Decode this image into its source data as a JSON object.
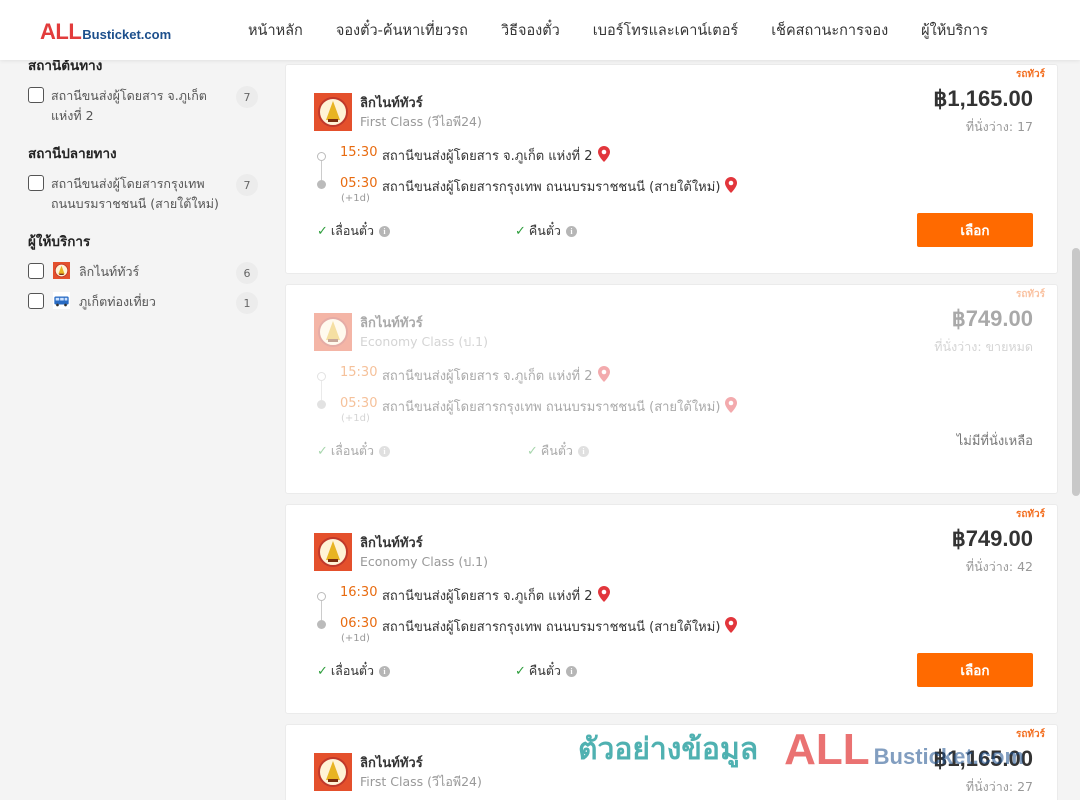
{
  "logo": {
    "all": "ALL",
    "rest": "Busticket.com"
  },
  "nav": [
    "หน้าหลัก",
    "จองตั๋ว-ค้นหาเที่ยวรถ",
    "วิธีจองตั๋ว",
    "เบอร์โทรและเคาน์เตอร์",
    "เช็คสถานะการจอง",
    "ผู้ให้บริการ"
  ],
  "sidebar": {
    "origin_heading": "สถานีต้นทาง",
    "origin_items": [
      {
        "label": "สถานีขนส่งผู้โดยสาร จ.ภูเก็ต แห่งที่ 2",
        "count": "7"
      }
    ],
    "dest_heading": "สถานีปลายทาง",
    "dest_items": [
      {
        "label": "สถานีขนส่งผู้โดยสารกรุงเทพ ถนนบรมราชชนนี (สายใต้ใหม่)",
        "count": "7"
      }
    ],
    "operator_heading": "ผู้ให้บริการ",
    "operator_items": [
      {
        "label": "ลิกไนท์ทัวร์",
        "count": "6"
      },
      {
        "label": "ภูเก็ตท่องเที่ยว",
        "count": "1"
      }
    ]
  },
  "trips": [
    {
      "tag": "รถทัวร์",
      "operator": "ลิกไนท์ทัวร์",
      "bus_class": "First Class (วีไอพี24)",
      "price": "฿1,165.00",
      "seats": "ที่นั่งว่าง: 17",
      "depart_time": "15:30",
      "depart_station": "สถานีขนส่งผู้โดยสาร จ.ภูเก็ต แห่งที่ 2",
      "arrive_time": "05:30",
      "arrive_station": "สถานีขนส่งผู้โดยสารกรุงเทพ ถนนบรมราชชนนี (สายใต้ใหม่)",
      "plus_day": "(+1d)",
      "policy_postpone": "เลื่อนตั๋ว",
      "policy_refund": "คืนตั๋ว",
      "action": "เลือก"
    },
    {
      "tag": "รถทัวร์",
      "operator": "ลิกไนท์ทัวร์",
      "bus_class": "Economy Class (ป.1)",
      "price": "฿749.00",
      "seats": "ที่นั่งว่าง: ขายหมด",
      "depart_time": "15:30",
      "depart_station": "สถานีขนส่งผู้โดยสาร จ.ภูเก็ต แห่งที่ 2",
      "arrive_time": "05:30",
      "arrive_station": "สถานีขนส่งผู้โดยสารกรุงเทพ ถนนบรมราชชนนี (สายใต้ใหม่)",
      "plus_day": "(+1d)",
      "policy_postpone": "เลื่อนตั๋ว",
      "policy_refund": "คืนตั๋ว",
      "sold_out_text": "ไม่มีที่นั่งเหลือ"
    },
    {
      "tag": "รถทัวร์",
      "operator": "ลิกไนท์ทัวร์",
      "bus_class": "Economy Class (ป.1)",
      "price": "฿749.00",
      "seats": "ที่นั่งว่าง: 42",
      "depart_time": "16:30",
      "depart_station": "สถานีขนส่งผู้โดยสาร จ.ภูเก็ต แห่งที่ 2",
      "arrive_time": "06:30",
      "arrive_station": "สถานีขนส่งผู้โดยสารกรุงเทพ ถนนบรมราชชนนี (สายใต้ใหม่)",
      "plus_day": "(+1d)",
      "policy_postpone": "เลื่อนตั๋ว",
      "policy_refund": "คืนตั๋ว",
      "action": "เลือก"
    },
    {
      "tag": "รถทัวร์",
      "operator": "ลิกไนท์ทัวร์",
      "bus_class": "First Class (วีไอพี24)",
      "price": "฿1,165.00",
      "seats": "ที่นั่งว่าง: 27"
    }
  ],
  "watermark": {
    "thai": "ตัวอย่างข้อมูล",
    "all": "ALL",
    "rest": "Busticket.com"
  },
  "colors": {
    "accent": "#ff6a00",
    "time": "#e86b10",
    "brand_red": "#e23c3c",
    "brand_blue": "#1c4f8c",
    "check": "#2e9e3d"
  }
}
